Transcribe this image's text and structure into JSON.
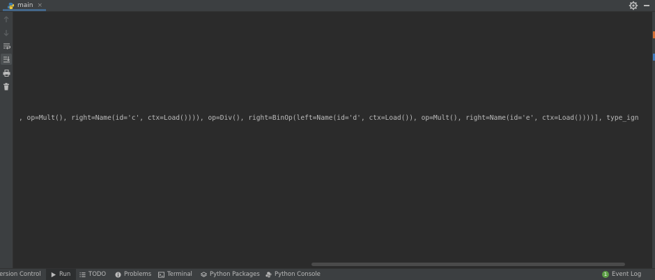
{
  "tab": {
    "label": "main",
    "close": "×"
  },
  "console": {
    "output_line": ", op=Mult(), right=Name(id='c', ctx=Load()))), op=Div(), right=BinOp(left=Name(id='d', ctx=Load()), op=Mult(), right=Name(id='e', ctx=Load())))], type_ign"
  },
  "bottom_bar": {
    "version_control": "Version Control",
    "run": "Run",
    "todo": "TODO",
    "problems": "Problems",
    "terminal": "Terminal",
    "python_packages": "Python Packages",
    "python_console": "Python Console",
    "event_log": "Event Log",
    "event_log_count": "1"
  },
  "colors": {
    "background": "#2b2b2b",
    "toolbar": "#3c3f41",
    "accent": "#4a88c7",
    "event_badge": "#5c9e45"
  }
}
